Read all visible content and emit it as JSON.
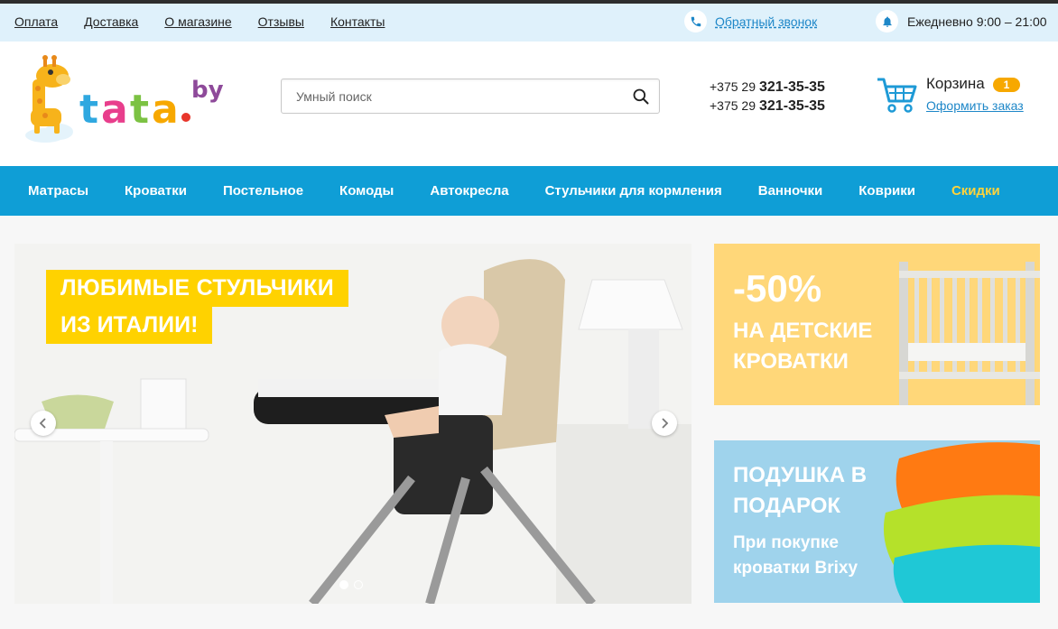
{
  "topbar": {
    "links": [
      "Оплата",
      "Доставка",
      "О магазине",
      "Отзывы",
      "Контакты"
    ],
    "callback_label": "Обратный звонок",
    "hours": "Ежедневно 9:00 – 21:00"
  },
  "header": {
    "logo_text": "tata",
    "logo_suffix": "by",
    "search_placeholder": "Умный поиск",
    "phones": [
      {
        "prefix": "+375 29",
        "number": "321-35-35"
      },
      {
        "prefix": "+375 29",
        "number": "321-35-35"
      }
    ],
    "cart": {
      "title": "Корзина",
      "count": "1",
      "order_link": "Оформить заказ"
    }
  },
  "nav": {
    "items": [
      "Матрасы",
      "Кроватки",
      "Постельное",
      "Комоды",
      "Автокресла",
      "Стульчики для кормления",
      "Ванночки",
      "Коврики",
      "Скидки"
    ]
  },
  "slider": {
    "headline_line1": "ЛЮБИМЫЕ СТУЛЬЧИКИ",
    "headline_line2": "ИЗ ИТАЛИИ!",
    "slides_count": 2,
    "active_slide": 1
  },
  "banners": {
    "crib": {
      "discount": "-50%",
      "line1": "НА ДЕТСКИЕ",
      "line2": "КРОВАТКИ"
    },
    "pillow": {
      "line1": "ПОДУШКА В",
      "line2": "ПОДАРОК",
      "sub1": "При покупке",
      "sub2": "кроватки Brixy"
    }
  },
  "colors": {
    "nav_bg": "#0f9ed6",
    "sale_text": "#ffd33b",
    "promo_yellow": "#ffd200",
    "banner_yellow": "#ffd779",
    "banner_blue": "#9fd3ec",
    "link_blue": "#1e87c8",
    "cart_badge": "#f7a800"
  },
  "icons": [
    "phone-icon",
    "bell-icon",
    "search-icon",
    "cart-icon",
    "arrow-left-icon",
    "arrow-right-icon",
    "giraffe-logo"
  ]
}
